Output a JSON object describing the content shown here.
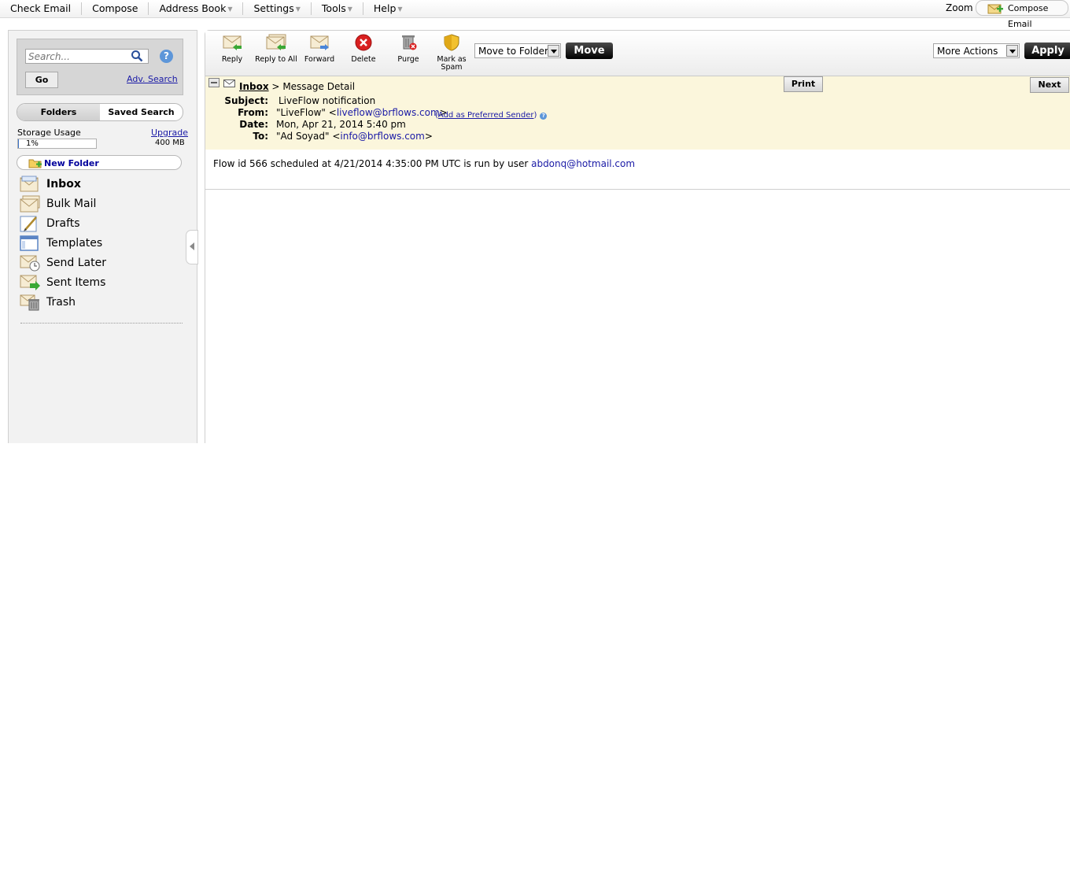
{
  "topbar": {
    "menu": [
      {
        "label": "Check Email",
        "has_caret": false
      },
      {
        "label": "Compose",
        "has_caret": false
      },
      {
        "label": "Address Book",
        "has_caret": true
      },
      {
        "label": "Settings",
        "has_caret": true
      },
      {
        "label": "Tools",
        "has_caret": true
      },
      {
        "label": "Help",
        "has_caret": true
      }
    ],
    "zoom_label": "Zoom",
    "compose_email_label": "Compose Email"
  },
  "sidebar": {
    "search_placeholder": "Search...",
    "go_label": "Go",
    "adv_search_label": "Adv. Search",
    "tabs": [
      {
        "label": "Folders",
        "active": true
      },
      {
        "label": "Saved Search",
        "active": false
      }
    ],
    "storage": {
      "label": "Storage Usage",
      "upgrade_label": "Upgrade",
      "percent_label": "1%",
      "used_fraction": 0.01,
      "total_label": "400 MB"
    },
    "new_folder_label": "New Folder",
    "folders": [
      {
        "label": "Inbox",
        "icon": "inbox-icon",
        "active": true
      },
      {
        "label": "Bulk Mail",
        "icon": "bulk-mail-icon",
        "active": false
      },
      {
        "label": "Drafts",
        "icon": "drafts-icon",
        "active": false
      },
      {
        "label": "Templates",
        "icon": "templates-icon",
        "active": false
      },
      {
        "label": "Send Later",
        "icon": "send-later-icon",
        "active": false
      },
      {
        "label": "Sent Items",
        "icon": "sent-items-icon",
        "active": false
      },
      {
        "label": "Trash",
        "icon": "trash-icon",
        "active": false
      }
    ]
  },
  "toolbar": {
    "reply_label": "Reply",
    "reply_all_label": "Reply to All",
    "forward_label": "Forward",
    "delete_label": "Delete",
    "purge_label": "Purge",
    "spam_label_1": "Mark as",
    "spam_label_2": "Spam",
    "move_select_value": "Move to Folder",
    "move_label": "Move",
    "more_actions_value": "More Actions",
    "apply_label": "Apply"
  },
  "message": {
    "breadcrumb_link": "Inbox",
    "breadcrumb_sep": ">",
    "breadcrumb_current": "Message Detail",
    "print_label": "Print",
    "next_label": "Next",
    "subject_label": "Subject:",
    "subject_value": "LiveFlow notification",
    "from_label": "From:",
    "from_name": "\"LiveFlow\" <",
    "from_email": "liveflow@brflows.com",
    "from_close": ">",
    "add_preferred_open": "(",
    "add_preferred_label": "Add as Preferred Sender",
    "add_preferred_close": ")",
    "help_glyph": "?",
    "date_label": "Date:",
    "date_value": "Mon, Apr 21, 2014 5:40 pm",
    "to_label": "To:",
    "to_name": "\"Ad Soyad\" <",
    "to_email": "info@brflows.com",
    "to_close": ">",
    "body_text": "Flow id 566 scheduled at 4/21/2014 4:35:00 PM UTC is run by user ",
    "body_link": "abdonq@hotmail.com"
  },
  "colors": {
    "header_bg": "#fbf6dc",
    "link": "#1a1aa6",
    "storage_fill": "#3b73c8",
    "delete_red": "#d92020",
    "help_blue": "#5d96d9"
  }
}
